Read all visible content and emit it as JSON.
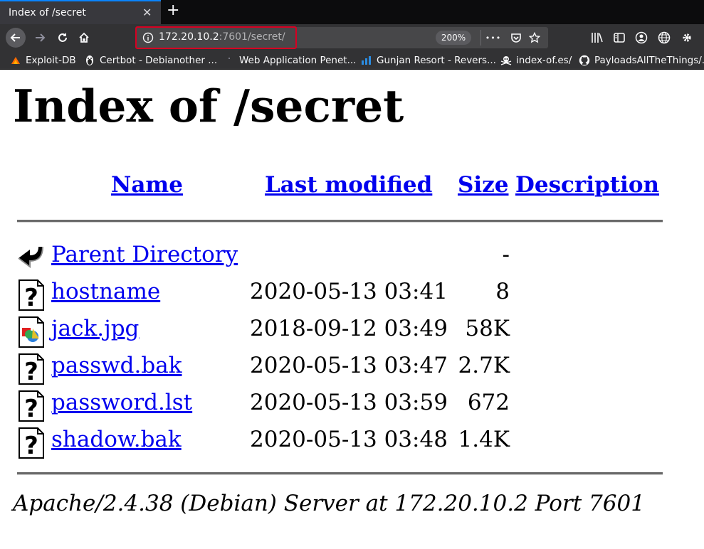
{
  "browser": {
    "tab_title": "Index of /secret",
    "tab_close": "✕",
    "new_tab": "+",
    "url_host": "172.20.10.2",
    "url_rest": ":7601/secret/",
    "zoom": "200%",
    "url_more": "•••",
    "bookmarks": [
      {
        "label": "Exploit-DB",
        "icon": "exploit-db-icon"
      },
      {
        "label": "Certbot - Debianother ...",
        "icon": "certbot-icon"
      },
      {
        "label": "Web Application Penet...",
        "icon": "web-app-icon"
      },
      {
        "label": "Gunjan Resort - Revers...",
        "icon": "gunjan-resort-icon"
      },
      {
        "label": "index-of.es/",
        "icon": "index-of-icon"
      },
      {
        "label": "PayloadsAllTheThings/...",
        "icon": "github-icon"
      }
    ]
  },
  "page": {
    "title": "Index of /secret",
    "columns": {
      "name": "Name",
      "last_modified": "Last modified",
      "size": "Size",
      "description": "Description"
    },
    "rows": [
      {
        "name": "Parent Directory",
        "date": "",
        "size": "-",
        "icon": "parent-directory-icon"
      },
      {
        "name": "hostname",
        "date": "2020-05-13 03:41",
        "size": "8",
        "icon": "unknown-file-icon"
      },
      {
        "name": "jack.jpg",
        "date": "2018-09-12 03:49",
        "size": "58K",
        "icon": "image-file-icon"
      },
      {
        "name": "passwd.bak",
        "date": "2020-05-13 03:47",
        "size": "2.7K",
        "icon": "unknown-file-icon"
      },
      {
        "name": "password.lst",
        "date": "2020-05-13 03:59",
        "size": "672",
        "icon": "unknown-file-icon"
      },
      {
        "name": "shadow.bak",
        "date": "2020-05-13 03:48",
        "size": "1.4K",
        "icon": "unknown-file-icon"
      }
    ],
    "footer": "Apache/2.4.38 (Debian) Server at 172.20.10.2 Port 7601"
  },
  "colors": {
    "link": "#0000ee",
    "url_highlight": "#d70022",
    "tab_accent": "#0a84ff"
  }
}
